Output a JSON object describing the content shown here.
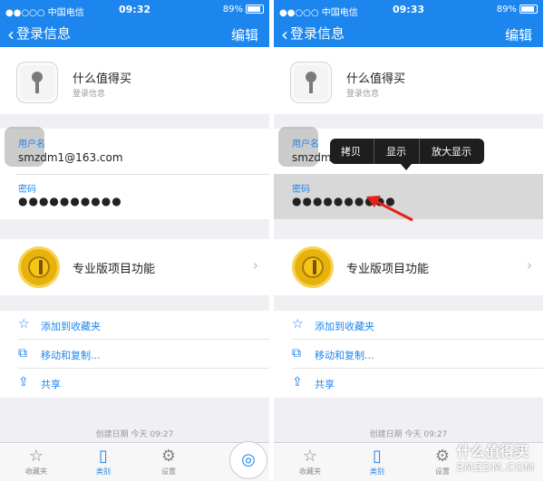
{
  "screens": [
    {
      "status": {
        "carrier": "●●○○○ 中国电信",
        "time": "09:32",
        "battery": "89%"
      },
      "nav": {
        "back_label": "登录信息",
        "edit_label": "编辑"
      },
      "item": {
        "title": "什么值得买",
        "subtitle": "登录信息"
      },
      "fields": {
        "username_label": "用户名",
        "username_value": "smzdm1@163.com",
        "password_label": "密码",
        "password_value": "●●●●●●●●●●"
      },
      "pro_feature": "专业版项目功能",
      "actions": [
        "添加到收藏夹",
        "移动和复制...",
        "共享"
      ],
      "created": "创建日期  今天 09:27",
      "tabs": [
        "收藏夹",
        "类别",
        "设置"
      ]
    },
    {
      "status": {
        "carrier": "●●○○○ 中国电信",
        "time": "09:33",
        "battery": "89%"
      },
      "nav": {
        "back_label": "登录信息",
        "edit_label": "编辑"
      },
      "item": {
        "title": "什么值得买",
        "subtitle": "登录信息"
      },
      "fields": {
        "username_label": "用户名",
        "username_value": "smzdm1@163.com",
        "password_label": "密码",
        "password_value": "●●●●●●●●●●"
      },
      "pro_feature": "专业版项目功能",
      "actions": [
        "添加到收藏夹",
        "移动和复制...",
        "共享"
      ],
      "created": "创建日期  今天 09:27",
      "tabs": [
        "收藏夹",
        "类别",
        "设置"
      ],
      "context_menu": [
        "拷贝",
        "显示",
        "放大显示"
      ]
    }
  ],
  "watermark": {
    "line1": "什么值得买",
    "line2": "SMZDM.COM"
  },
  "colors": {
    "accent": "#1c86ee",
    "highlight": "#d8d8d8",
    "arrow": "#e8201a"
  }
}
